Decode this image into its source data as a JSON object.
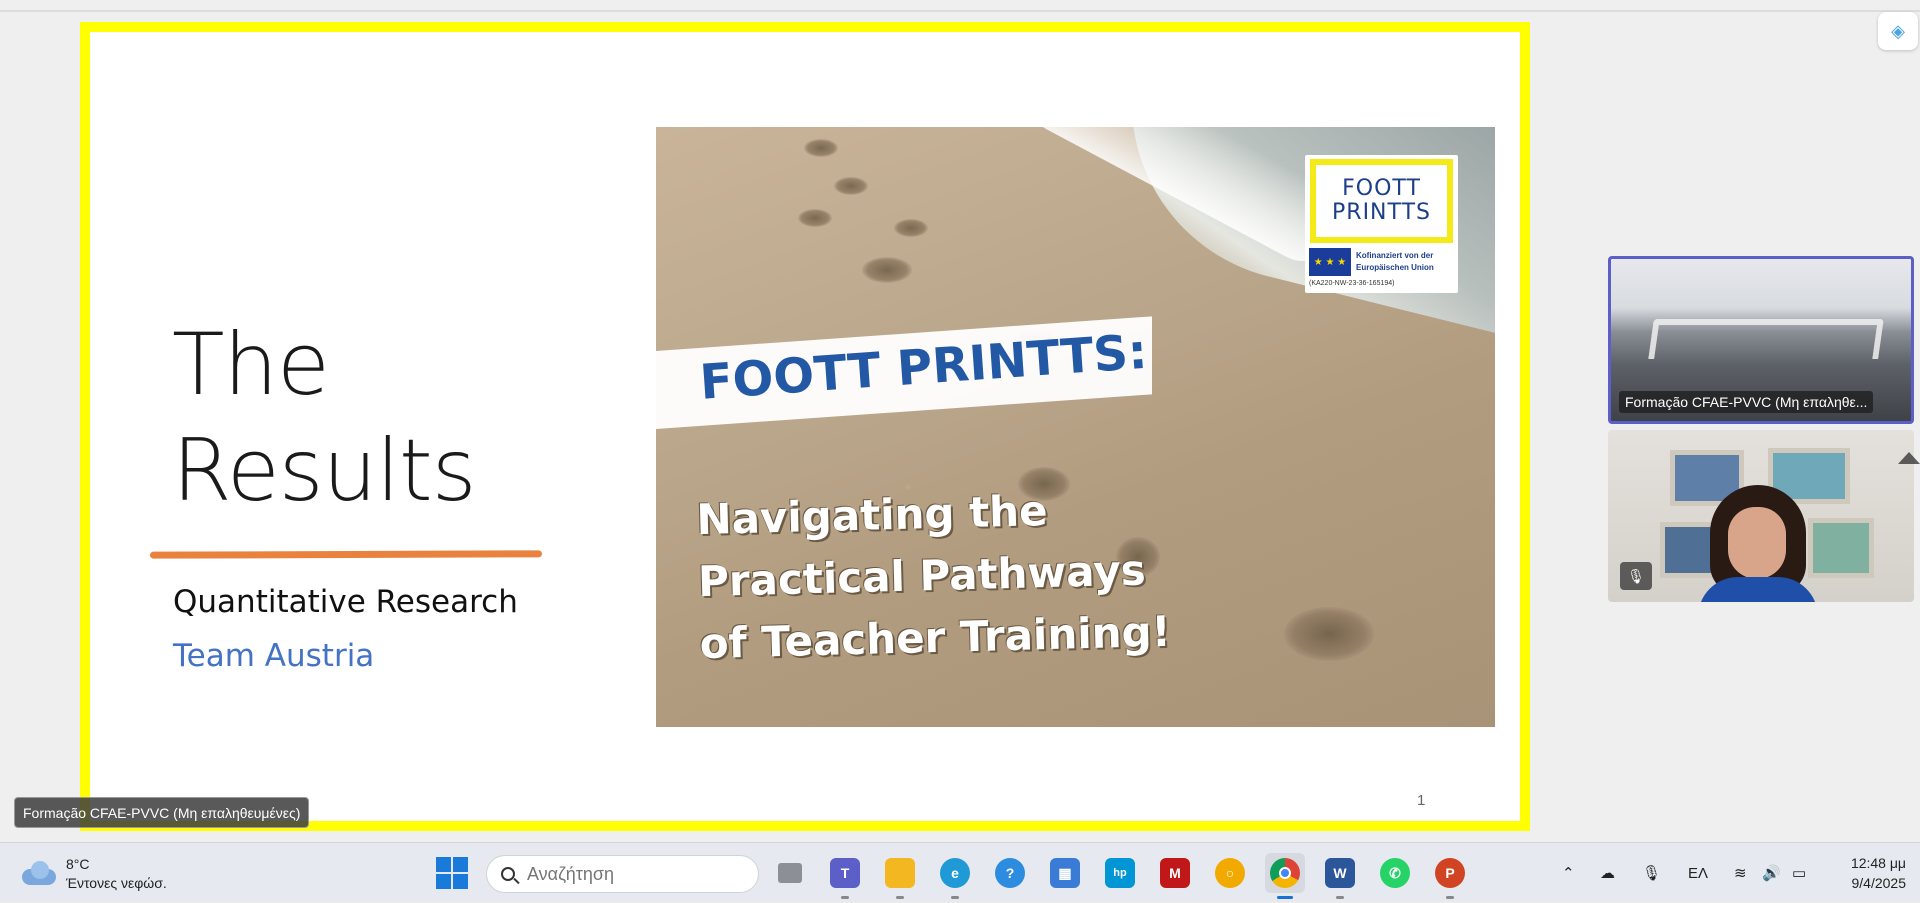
{
  "slide": {
    "title_line1": "The",
    "title_line2": "Results",
    "subtitle": "Quantitative Research",
    "team": "Team Austria",
    "page_number": "1",
    "banner_title": "FOOTT PRINTTS:",
    "banner_lines": [
      "Navigating the",
      "Practical Pathways",
      "of Teacher Training!"
    ],
    "logo_line1": "FOOTT",
    "logo_line2": "PRINTTS",
    "eu_line1": "Kofinanziert von der",
    "eu_line2": "Europäischen Union",
    "eu_code": "(KA220-NW-23-36-165194)"
  },
  "videos": {
    "participant1_label": "Formação CFAE-PVVC (Μη επαληθε...",
    "participant_tag": "Formação CFAE-PVVC (Μη επαληθευμένες)"
  },
  "taskbar": {
    "weather_temp": "8°C",
    "weather_desc": "Έντονες νεφώσ.",
    "search_placeholder": "Αναζήτηση",
    "language": "ΕΛ",
    "time": "12:48 μμ",
    "date": "9/4/2025",
    "apps": [
      "task-view",
      "teams",
      "file-explorer",
      "edge",
      "get-help",
      "microsoft-store",
      "myhp",
      "mcafee",
      "norton",
      "chrome",
      "word",
      "whatsapp",
      "powerpoint"
    ]
  },
  "colors": {
    "slide_border": "#ffff00",
    "accent_underline": "#e8823e",
    "team_text": "#4472c4",
    "active_speaker_border": "#5b5fc7"
  }
}
